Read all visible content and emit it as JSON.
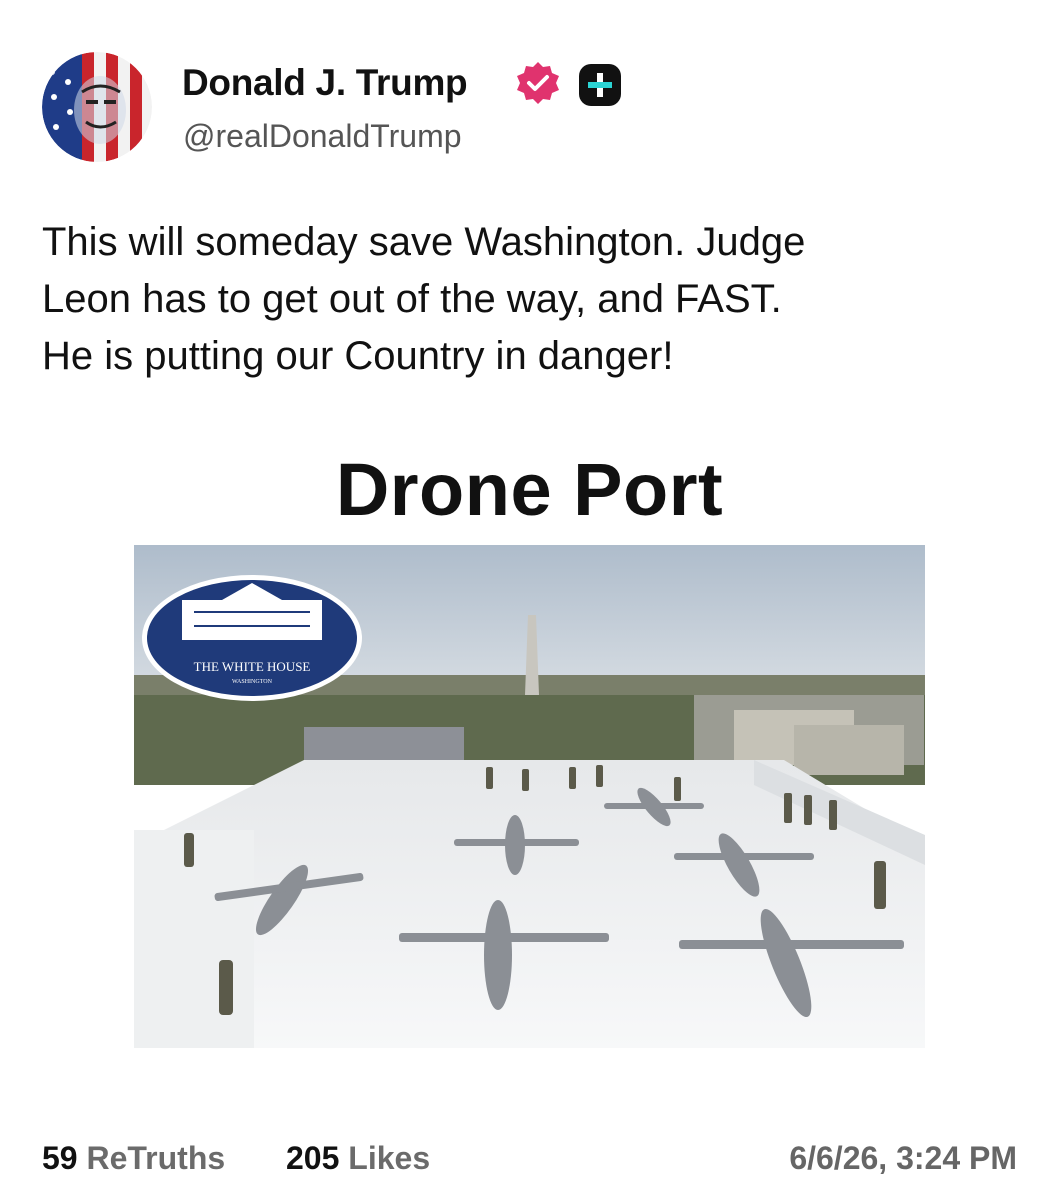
{
  "author": {
    "display_name": "Donald J. Trump",
    "handle": "@realDonaldTrump",
    "avatar_icon": "avatar-image",
    "verified_icon": "verified-badge-icon",
    "plus_icon": "plus-badge-icon"
  },
  "post": {
    "lines": [
      "This will someday save Washington. Judge",
      "Leon has to get out of the way, and FAST.",
      "He is putting our Country in danger!"
    ]
  },
  "media": {
    "title": "Drone Port",
    "seal_text": "THE WHITE HOUSE",
    "seal_subtext": "WASHINGTON"
  },
  "footer": {
    "retruths_count": "59",
    "retruths_label": "ReTruths",
    "likes_count": "205",
    "likes_label": "Likes",
    "timestamp": "6/6/26, 3:24 PM"
  },
  "colors": {
    "verified": "#e0336e",
    "badge_bg": "#111111",
    "badge_plus": "#2bd4d4",
    "muted_text": "#6b6b6b"
  }
}
